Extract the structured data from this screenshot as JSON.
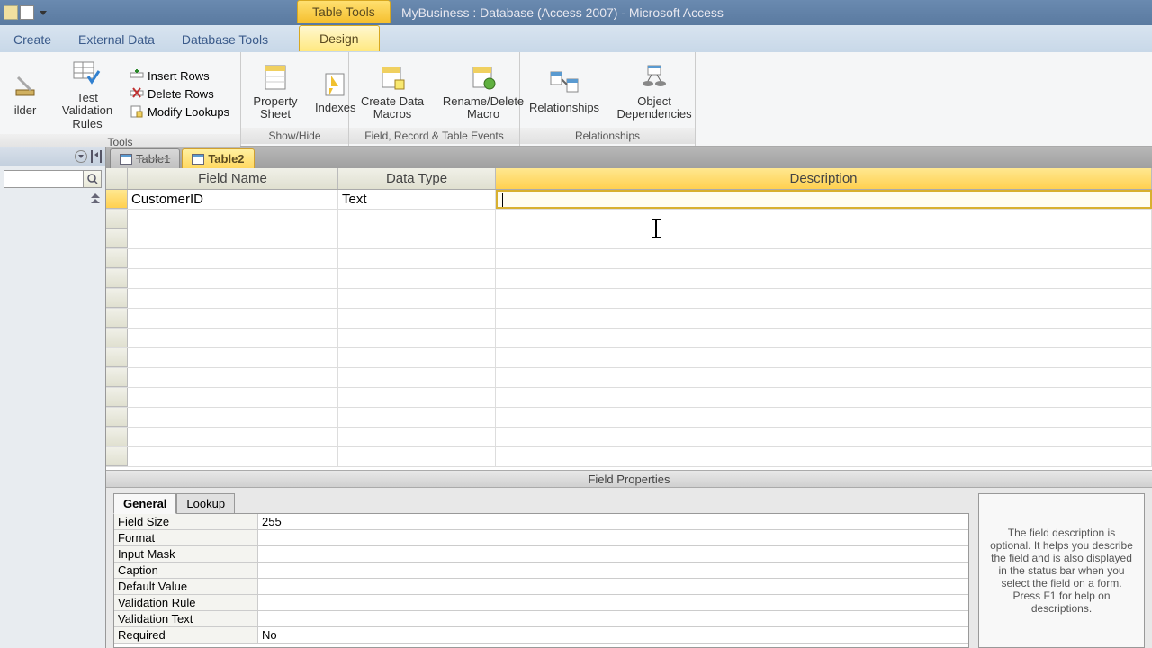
{
  "title": "MyBusiness : Database (Access 2007)  -  Microsoft Access",
  "contextual_tab_group": "Table Tools",
  "tabs": {
    "create": "Create",
    "external": "External Data",
    "dbtools": "Database Tools",
    "design": "Design"
  },
  "ribbon": {
    "tools": {
      "label": "Tools",
      "builder": "ilder",
      "test_rules": "Test Validation Rules",
      "insert_rows": "Insert Rows",
      "delete_rows": "Delete Rows",
      "modify_lookups": "Modify Lookups"
    },
    "showhide": {
      "label": "Show/Hide",
      "property_sheet": "Property Sheet",
      "indexes": "Indexes"
    },
    "events": {
      "label": "Field, Record & Table Events",
      "create_macros": "Create Data Macros",
      "rename_macro": "Rename/Delete Macro"
    },
    "relationships": {
      "label": "Relationships",
      "relationships": "Relationships",
      "dependencies": "Object Dependencies"
    }
  },
  "nav": {
    "search_placeholder": ""
  },
  "doc_tabs": [
    {
      "label": "Table1"
    },
    {
      "label": "Table2"
    }
  ],
  "grid": {
    "headers": {
      "field_name": "Field Name",
      "data_type": "Data Type",
      "description": "Description"
    },
    "rows": [
      {
        "field_name": "CustomerID",
        "data_type": "Text",
        "description": ""
      }
    ],
    "empty_rows": 13
  },
  "field_properties": {
    "title": "Field Properties",
    "tabs": {
      "general": "General",
      "lookup": "Lookup"
    },
    "rows": [
      {
        "name": "Field Size",
        "value": "255"
      },
      {
        "name": "Format",
        "value": ""
      },
      {
        "name": "Input Mask",
        "value": ""
      },
      {
        "name": "Caption",
        "value": ""
      },
      {
        "name": "Default Value",
        "value": ""
      },
      {
        "name": "Validation Rule",
        "value": ""
      },
      {
        "name": "Validation Text",
        "value": ""
      },
      {
        "name": "Required",
        "value": "No"
      }
    ],
    "help": "The field description is optional. It helps you describe the field and is also displayed in the status bar when you select the field on a form. Press F1 for help on descriptions."
  }
}
